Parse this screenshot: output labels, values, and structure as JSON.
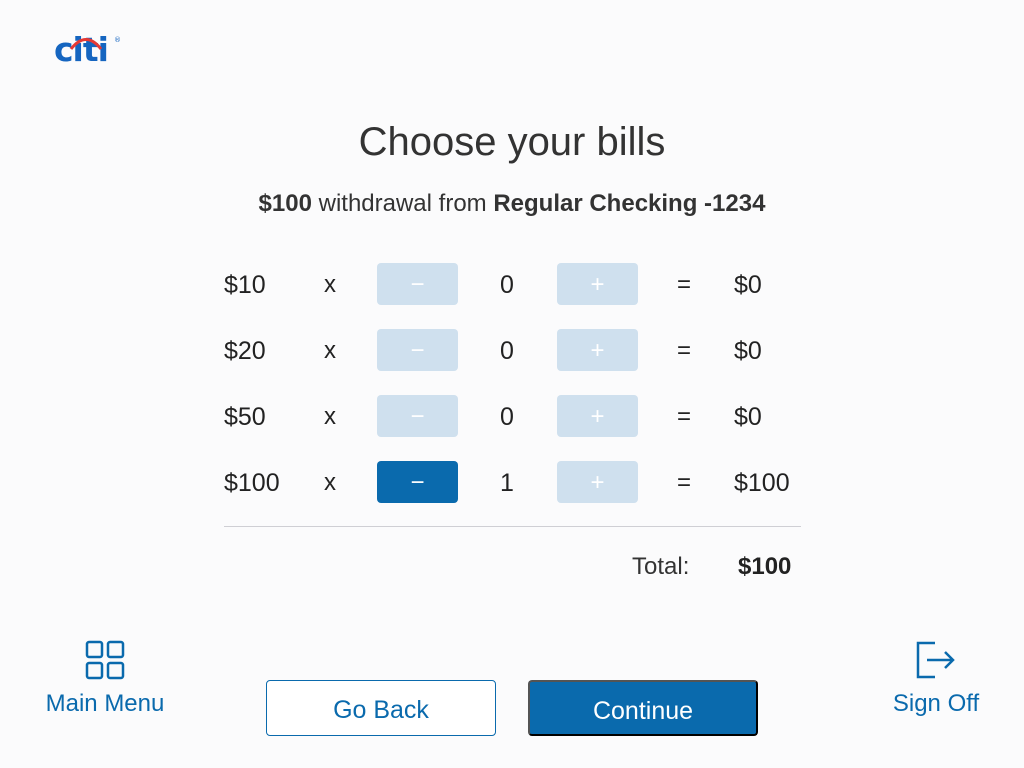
{
  "brand": {
    "name": "citi",
    "accent": "#0a6aad",
    "arc_color": "#e53935"
  },
  "header": {
    "title": "Choose your bills",
    "subtitle": {
      "amount": "$100",
      "middle": " withdrawal from ",
      "account": "Regular Checking -1234"
    }
  },
  "bills": [
    {
      "denom": "$10",
      "times": "x",
      "minus": "−",
      "qty": "0",
      "plus": "+",
      "eq": "=",
      "amount": "$0",
      "minus_active": false
    },
    {
      "denom": "$20",
      "times": "x",
      "minus": "−",
      "qty": "0",
      "plus": "+",
      "eq": "=",
      "amount": "$0",
      "minus_active": false
    },
    {
      "denom": "$50",
      "times": "x",
      "minus": "−",
      "qty": "0",
      "plus": "+",
      "eq": "=",
      "amount": "$0",
      "minus_active": false
    },
    {
      "denom": "$100",
      "times": "x",
      "minus": "−",
      "qty": "1",
      "plus": "+",
      "eq": "=",
      "amount": "$100",
      "minus_active": true
    }
  ],
  "total": {
    "label": "Total:",
    "value": "$100"
  },
  "nav": {
    "main_menu": {
      "label": "Main Menu",
      "icon": "grid-icon"
    },
    "sign_off": {
      "label": "Sign Off",
      "icon": "sign-out-icon"
    }
  },
  "actions": {
    "go_back": "Go Back",
    "continue": "Continue"
  }
}
